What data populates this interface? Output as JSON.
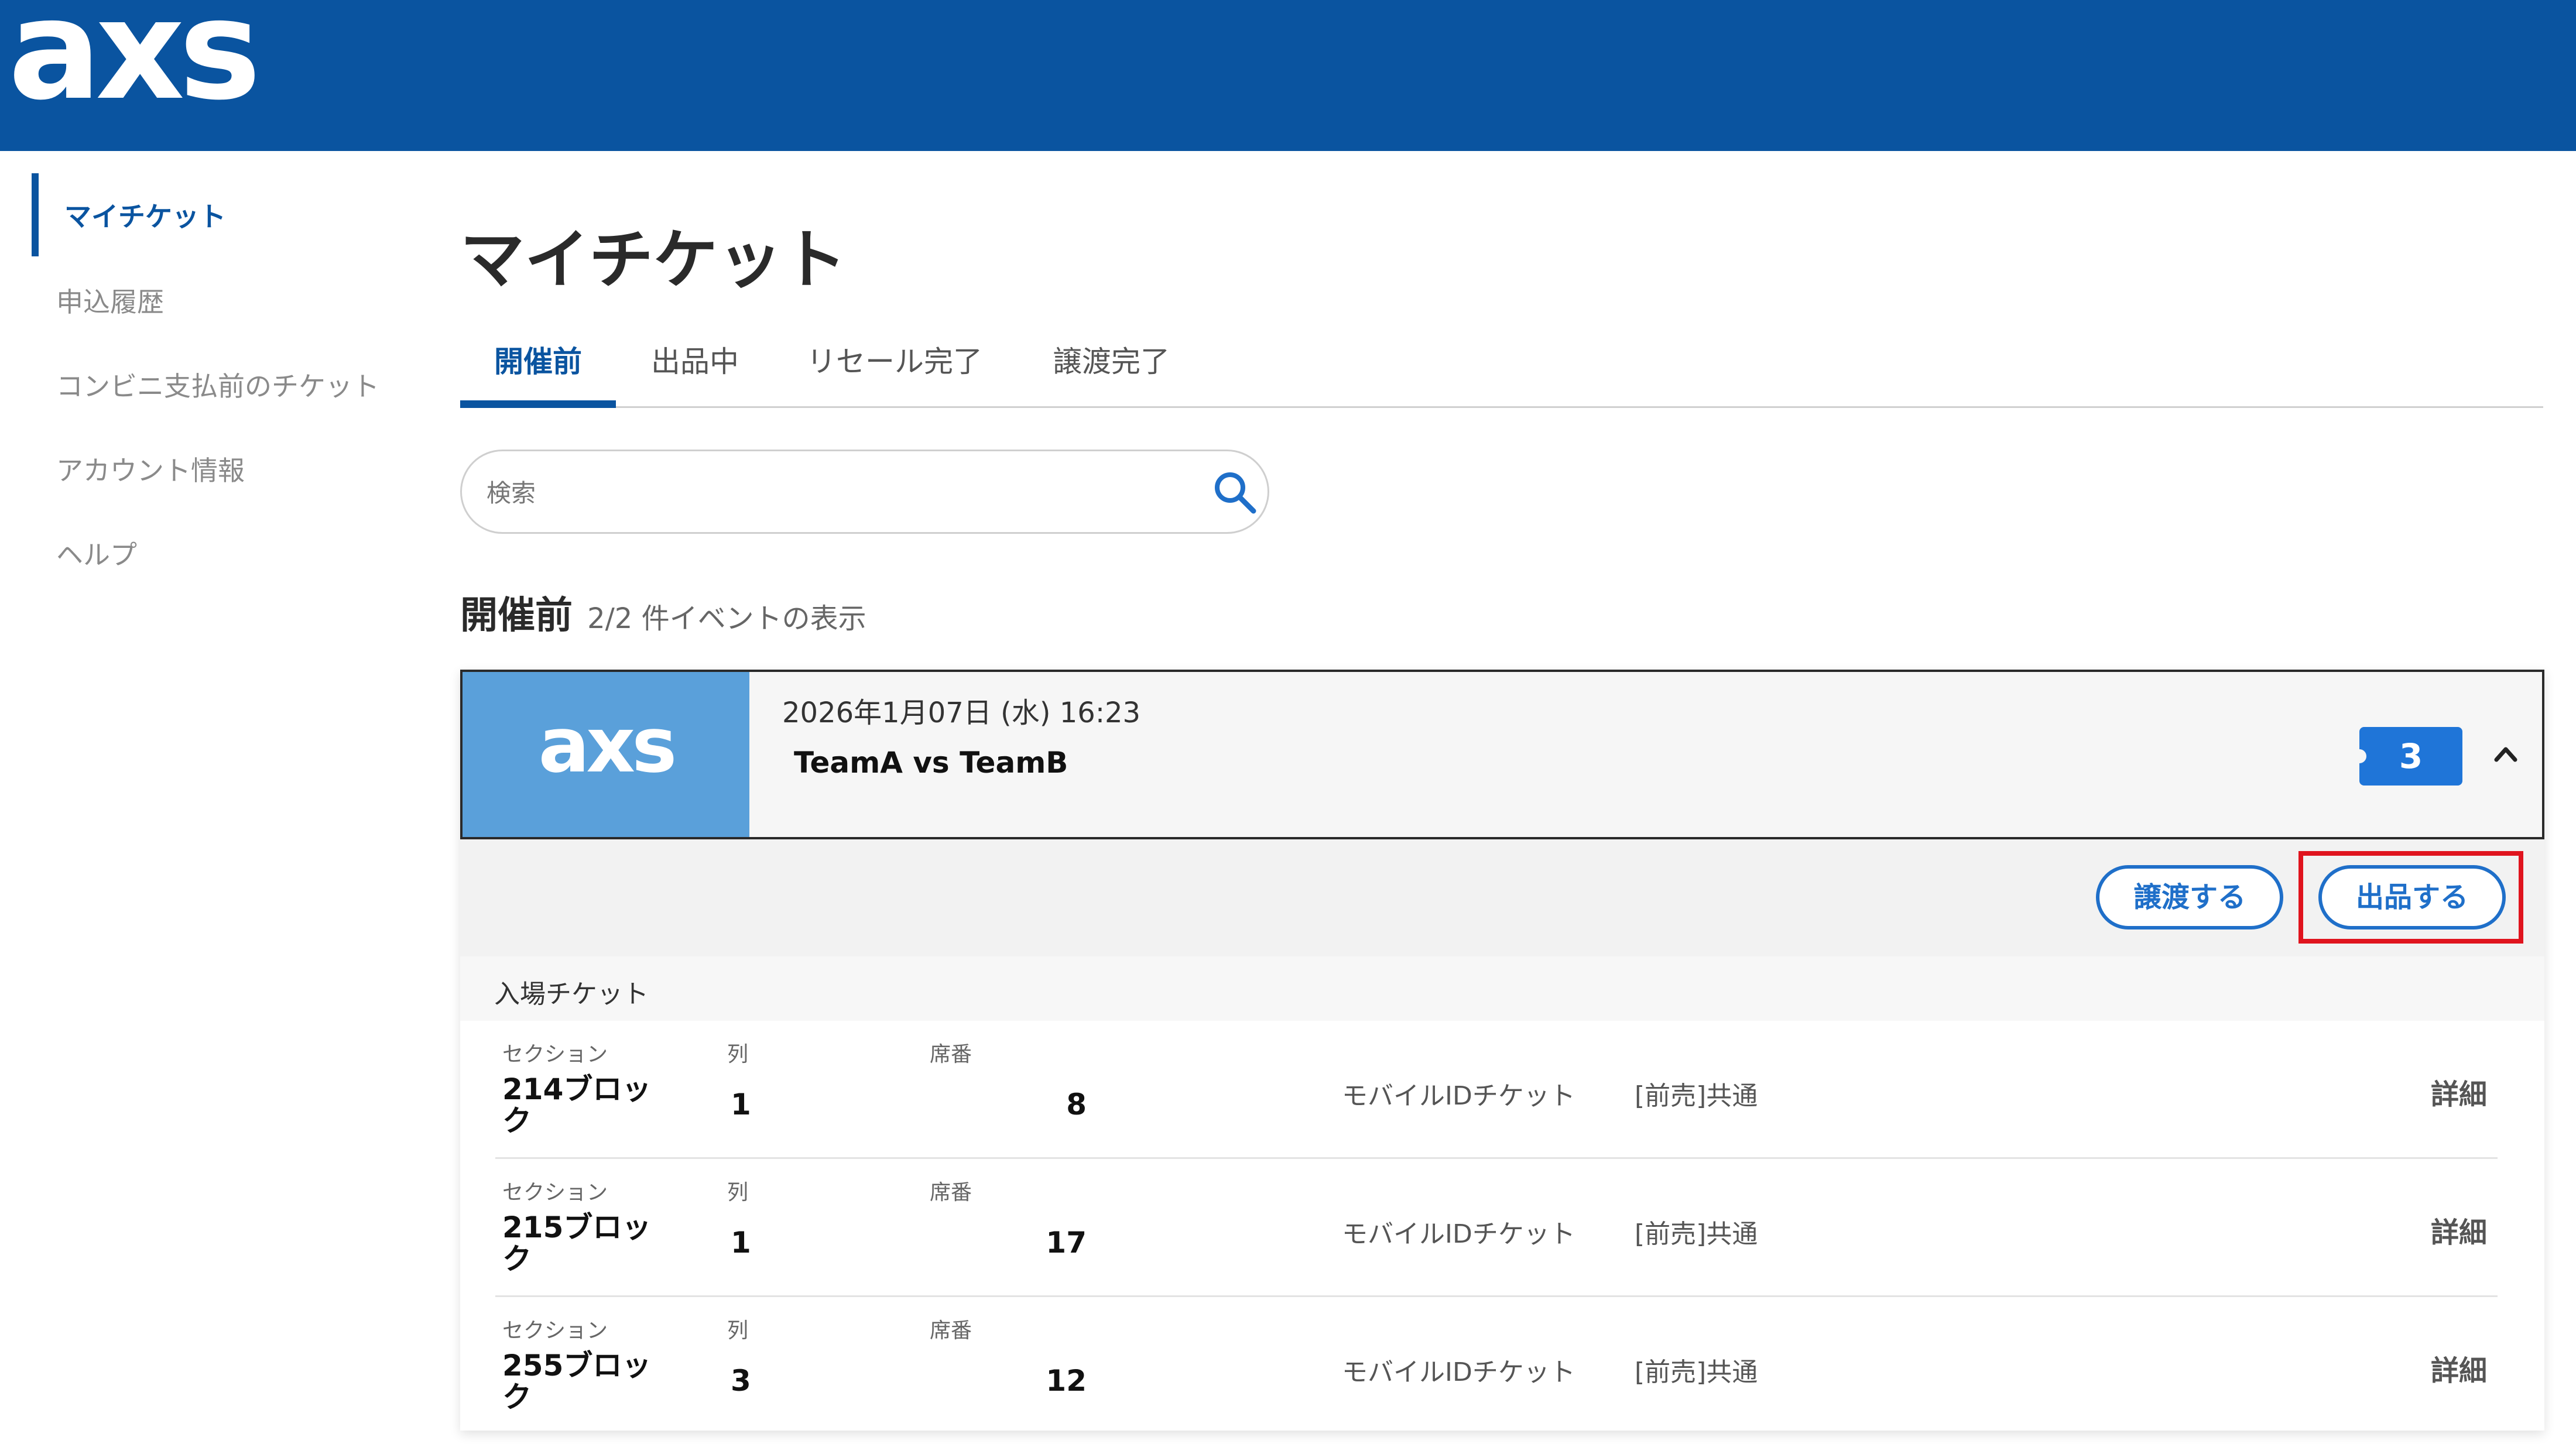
{
  "header": {
    "logo_text": "axs"
  },
  "sidebar": {
    "items": [
      {
        "label": "マイチケット",
        "active": true
      },
      {
        "label": "申込履歴"
      },
      {
        "label": "コンビニ支払前のチケット"
      },
      {
        "label": "アカウント情報"
      },
      {
        "label": "ヘルプ"
      }
    ]
  },
  "main": {
    "title": "マイチケット",
    "tabs": [
      {
        "label": "開催前",
        "active": true
      },
      {
        "label": "出品中"
      },
      {
        "label": "リセール完了"
      },
      {
        "label": "譲渡完了"
      }
    ],
    "search": {
      "placeholder": "検索",
      "icon": "search-icon"
    },
    "section": {
      "title": "開催前",
      "count_text": "2/2 件イベントの表示"
    },
    "event": {
      "thumbnail_text": "axs",
      "date": "2026年1月07日 (水) 16:23",
      "name": "TeamA vs TeamB",
      "ticket_count": "3",
      "collapse_icon": "chevron-up-icon",
      "actions": {
        "transfer": "譲渡する",
        "list": "出品する"
      },
      "admission_label": "入場チケット",
      "column_labels": {
        "section": "セクション",
        "row": "列",
        "seat": "席番"
      },
      "tickets": [
        {
          "section": "214ブロック",
          "row": "1",
          "seat": "8",
          "type": "モバイルIDチケット",
          "price": "[前売]共通",
          "detail": "詳細"
        },
        {
          "section": "215ブロック",
          "row": "1",
          "seat": "17",
          "type": "モバイルIDチケット",
          "price": "[前売]共通",
          "detail": "詳細"
        },
        {
          "section": "255ブロック",
          "row": "3",
          "seat": "12",
          "type": "モバイルIDチケット",
          "price": "[前売]共通",
          "detail": "詳細"
        }
      ]
    }
  },
  "colors": {
    "brand": "#0a54a0",
    "accent": "#1f6fc9",
    "badge": "#1f75d8",
    "highlight": "#e0141e",
    "thumbnail": "#5aa0da"
  }
}
